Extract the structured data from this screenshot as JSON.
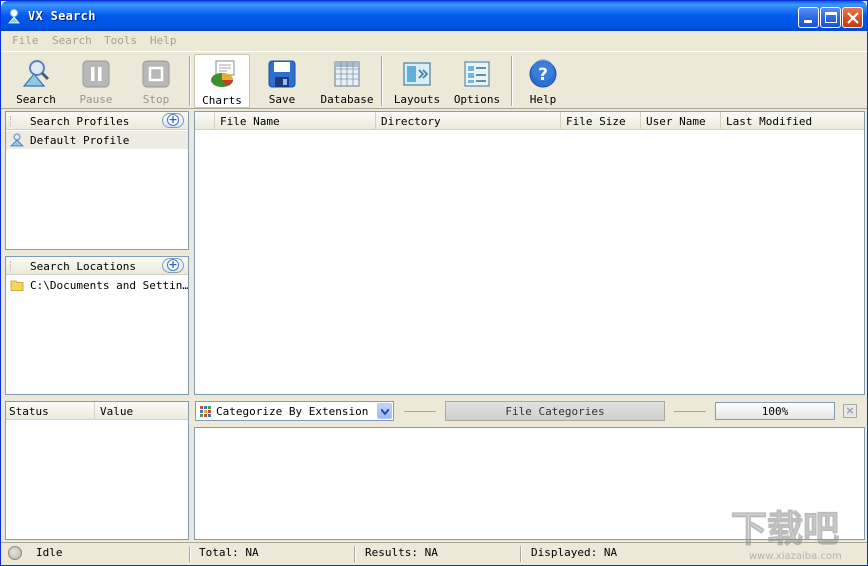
{
  "window": {
    "title": "VX Search"
  },
  "menu": [
    "File",
    "Search",
    "Tools",
    "Help"
  ],
  "toolbar": {
    "search": "Search",
    "pause": "Pause",
    "stop": "Stop",
    "charts": "Charts",
    "save": "Save",
    "database": "Database",
    "layouts": "Layouts",
    "options": "Options",
    "help": "Help"
  },
  "profiles_panel": {
    "title": "Search Profiles",
    "items": [
      "Default Profile"
    ]
  },
  "locations_panel": {
    "title": "Search Locations",
    "items": [
      "C:\\Documents and Settin…"
    ]
  },
  "status_panel": {
    "columns": [
      "Status",
      "Value"
    ]
  },
  "results_table": {
    "columns": [
      "File Name",
      "Directory",
      "File Size",
      "User Name",
      "Last Modified"
    ]
  },
  "categorize": {
    "selected": "Categorize By Extension",
    "file_categories_label": "File Categories",
    "zoom": "100%"
  },
  "statusbar": {
    "state": "Idle",
    "total": "Total: NA",
    "results": "Results: NA",
    "displayed": "Displayed: NA"
  },
  "colors": {
    "titlebar": "#0054E3",
    "window_bg": "#ECE9D8",
    "border": "#7F9DB9"
  },
  "watermark": {
    "brand": "下载吧",
    "url": "www.xiazaiba.com"
  }
}
